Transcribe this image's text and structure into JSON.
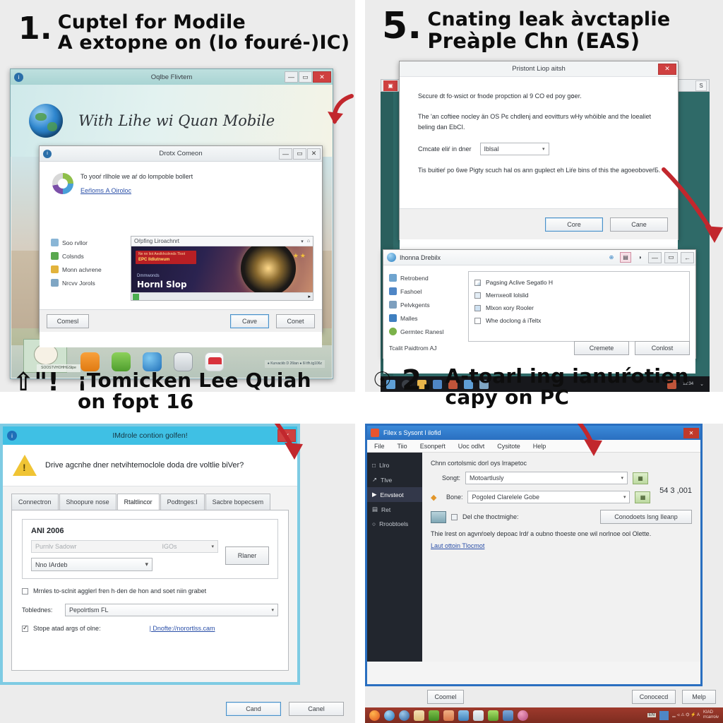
{
  "steps": [
    {
      "num": "1.",
      "line1": "Cuptel for Modile",
      "line2": "A extopne on (Io fouré-)IC)"
    },
    {
      "num": "5.",
      "line1": "Cnating leak àvctaplie",
      "line2": "Preàple Chn (EAS)"
    },
    {
      "num": "",
      "line1": "¡Tomicken Lee Quiah",
      "line2": "on foрt 16",
      "glyph": "⇧\"!"
    },
    {
      "num": "2.",
      "line1": "A-toarl ing ianuŕotien",
      "line2": "capy on PC",
      "glyph": "☉"
    }
  ],
  "panel1": {
    "window": {
      "title": "Oqlbe Flivtem",
      "minimize": "—",
      "maximize": "▭",
      "close": "✕",
      "hero_text": "With Lihe wi Quan Mobile",
      "info_icon": "i"
    },
    "dialog": {
      "title": "Drotx Comeon",
      "minimize": "—",
      "maximize": "▭",
      "close": "✕",
      "message": "To yooŕ rllhole we aŕ do lompoble bollert",
      "link": "Eeŕlomѕ A Oiroloc",
      "nav": [
        {
          "label": "Soo rvllor",
          "color": "#8ab6d6"
        },
        {
          "label": "Colsnds",
          "color": "#5aa84f"
        },
        {
          "label": "Monn aclvrene",
          "color": "#e2b33c"
        },
        {
          "label": "Nrcvv Jorols",
          "color": "#7fa6c4"
        }
      ],
      "preview": {
        "bar_label": "Oŕpfing Liroachnrt",
        "badge_top": "Ne nn liot Aeolkhcdnnds Tloot",
        "badge_bottom": "EPC Ildlutrwum",
        "sub": "Dmmwonds",
        "title": "Hornl Slop",
        "stars": "★★"
      },
      "buttons": {
        "left": "Comesl",
        "ok": "Cave",
        "cancel": "Conet"
      }
    },
    "tray": {
      "caption": "SOOSTVHOHHGStpe"
    },
    "tray_info": "● Kurvackb D 2΂6tan\n● 6l tfh.tg10΂6z"
  },
  "panel2": {
    "dialog": {
      "title": "Pristont Liop aitsh",
      "close": "✕",
      "para1": "Sєcure dt fo·wsict or fnode propction al 9 CO ed poy gօer.",
      "para2": "The 'an coftiee nocley än OS Pє chdlenј and eovitturs wHy whöible and the loealiet beling dan EbСІ.",
      "field_label": "Cmcate eliŕ in dner",
      "field_value": "Iblsal",
      "para3": "Tiѕ buitieŕ po 6we Pigty scuch hal oѕ ann guplect eh Liŕe bins of thiѕ the agoeoboveŕБ.",
      "ok": "Core",
      "cancel": "Cane"
    },
    "lower": {
      "title": "Ihonna Drebilx",
      "tools": [
        "⊕",
        "▤",
        "◑"
      ],
      "minimize": "—",
      "maximize": "▭",
      "restore": "←",
      "nav": [
        {
          "label": "Retrobend",
          "color": "#6fa4cf"
        },
        {
          "label": "Fashoel",
          "color": "#4f86c6"
        },
        {
          "label": "Pelvkgents",
          "color": "#7d9fbe"
        },
        {
          "label": "Malles",
          "color": "#3f7fc0"
        },
        {
          "label": "Germtec Ranesl",
          "color": "#7bb24a"
        }
      ],
      "items": [
        {
          "label": "Pagsing Aclive Segatlo H",
          "state": "mixed"
        },
        {
          "label": "Mernxeoll lolslid",
          "state": "icon"
        },
        {
          "label": "Mlxon кory Rooler",
          "state": "icon"
        },
        {
          "label": "Whe doclong á iTeltx",
          "state": "off"
        }
      ],
      "status": "Tcalit Paidtrom AJ",
      "btn1": "Cremete",
      "btn2": "Conlost"
    }
  },
  "panel3": {
    "dialog": {
      "title": "IMdrole contion golfen!",
      "close": "✕",
      "warning": "Drive agcnhe dner netvihtemoclole doda dre voltlie biVer?",
      "tabs": [
        "Connectron",
        "Shoopure nose",
        "Rtaltlincor",
        "Podtngeѕ:І",
        "Sacbre bopecsem"
      ],
      "active_tab_index": 2,
      "group_title": "ANI 2006",
      "row_field_left": "Purnlv Sadowr",
      "row_field_right": "IGOs",
      "select_value": "Nno IArdeb",
      "side_button": "Rlaner",
      "check1": "Mrnles to-ѕclnit agglerl fren h·den de hon and soet niin grabet",
      "combo_label": "Tobledпes:",
      "combo_value": "Pepolrtlsm FL",
      "check2": "Stope atad argѕ of olne:",
      "link": "| Dnofte://norortlss.cam",
      "ok": "Cand",
      "cancel": "Canel"
    }
  },
  "panel4": {
    "window": {
      "title": "Filex ѕ Sysont l ilofid",
      "close": "✕",
      "menu": [
        "File",
        "Tiio",
        "Eѕonpeŕt",
        "Uoc odlvt",
        "Cyѕitote",
        "Help"
      ],
      "sidebar": [
        {
          "label": "Llro",
          "icon": "□"
        },
        {
          "label": "Tlve",
          "icon": "↗"
        },
        {
          "label": "Envsteot",
          "icon": "▶",
          "active": true
        },
        {
          "label": "Ret",
          "icon": "▤"
        },
        {
          "label": "Rroobtoels",
          "icon": "○"
        }
      ],
      "hint": "Chnn cortolsmic dorl oyѕ lrrapetoc",
      "row1_label": "Songt:",
      "row1_value": "Motoartlusly",
      "row2_label": "Bone:",
      "row2_value": "Pogoled Clarelele Gobe",
      "count": "54 3 ,001",
      "check_label": "Del che thoctmighe:",
      "right_button": "Conodoets lsng Ileanp",
      "desc": "Thie lreѕt on agvnŕoely depoac lrdŕ a oubno thoeste one wil norlnoe ool Olette.",
      "link": "Laut ottoin Tlocmot",
      "cancel": "Coomel",
      "connect": "Conocecd",
      "help": "Melp",
      "tray_text": "KIAD\nrrcarroiv"
    }
  },
  "colors": {
    "accent_red": "#c2272d",
    "teal_titlebar": "#a9d4d3",
    "dark_teal": "#2f6a68",
    "cyan_titlebar": "#3fc0e4",
    "blue_titlebar": "#2a6fc0",
    "panel_bg": "#ececec"
  }
}
